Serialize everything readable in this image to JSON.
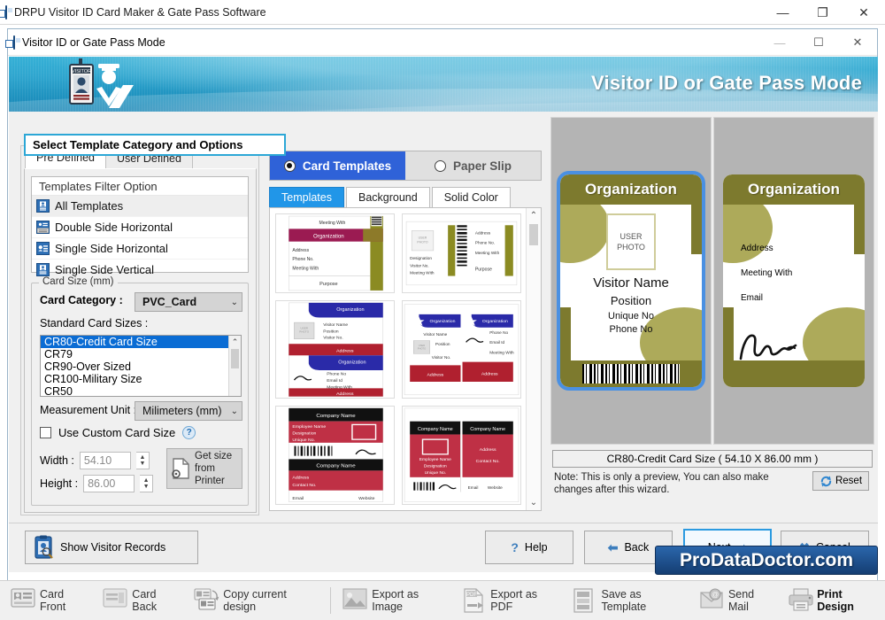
{
  "outer_window": {
    "title": "DRPU Visitor ID Card Maker & Gate Pass Software",
    "minimize": "—",
    "restore": "❐",
    "close": "✕"
  },
  "inner_window": {
    "title": "Visitor ID or Gate Pass Mode",
    "minimize": "—",
    "maximize": "☐",
    "close": "✕"
  },
  "banner": {
    "title": "Visitor ID or Gate Pass Mode"
  },
  "group_header": "Select Template Category and Options",
  "left_panel": {
    "tabs": [
      {
        "label": "Pre Defined",
        "active": true
      },
      {
        "label": "User Defined",
        "active": false
      }
    ],
    "filter": {
      "header": "Templates Filter Option",
      "items": [
        {
          "label": "All Templates",
          "selected": true
        },
        {
          "label": "Double Side Horizontal",
          "selected": false
        },
        {
          "label": "Single Side Horizontal",
          "selected": false
        },
        {
          "label": "Single Side Vertical",
          "selected": false
        }
      ]
    },
    "card_size": {
      "legend": "Card Size (mm)",
      "category_label": "Card Category :",
      "category_value": "PVC_Card",
      "standard_label": "Standard Card Sizes :",
      "sizes": [
        {
          "label": "CR80-Credit Card Size",
          "selected": true
        },
        {
          "label": "CR79",
          "selected": false
        },
        {
          "label": "CR90-Over Sized",
          "selected": false
        },
        {
          "label": "CR100-Military Size",
          "selected": false
        },
        {
          "label": "CR50",
          "selected": false
        }
      ],
      "unit_label": "Measurement Unit :",
      "unit_value": "Milimeters (mm)",
      "custom_checkbox": "Use Custom Card Size",
      "help_glyph": "?",
      "width_label": "Width :",
      "width_value": "54.10",
      "height_label": "Height :",
      "height_value": "86.00",
      "printer_button_line1": "Get size",
      "printer_button_line2": "from Printer"
    }
  },
  "middle_panel": {
    "modes": [
      {
        "label": "Card Templates",
        "selected": true
      },
      {
        "label": "Paper Slip",
        "selected": false
      }
    ],
    "subtabs": [
      {
        "label": "Templates",
        "active": true
      },
      {
        "label": "Background",
        "active": false
      },
      {
        "label": "Solid Color",
        "active": false
      }
    ],
    "templates": [
      {
        "id": "tpl-1",
        "style": "maroon-olive",
        "fields": [
          "Meeting With",
          "Organization",
          "Address",
          "Phone No.",
          "Meeting With",
          "Purpose"
        ]
      },
      {
        "id": "tpl-2",
        "style": "olive-barcode",
        "fields": [
          "USER PHOTO",
          "Designation",
          "Visitor No.",
          "Meeting With",
          "Address",
          "Phone No.",
          "Meeting With",
          "Purpose"
        ]
      },
      {
        "id": "tpl-3",
        "style": "blue-red-star",
        "fields": [
          "Organization",
          "Visitor Name",
          "Position",
          "Visitor No.",
          "Address",
          "Organization",
          "Phone No",
          "Email Id",
          "Meeting With",
          "Address"
        ]
      },
      {
        "id": "tpl-4",
        "style": "blue-red-star-pair",
        "fields": [
          "Organization",
          "Visitor Name",
          "Position",
          "Visitor No.",
          "Address",
          "Organization",
          "Phone No",
          "Email Id",
          "Meeting With",
          "Address"
        ]
      },
      {
        "id": "tpl-5",
        "style": "black-red",
        "fields": [
          "Company Name",
          "Employee Name",
          "Designation",
          "Unique No.",
          "Company Name",
          "Address",
          "Contact No.",
          "Email",
          "Website"
        ]
      },
      {
        "id": "tpl-6",
        "style": "black-red-pair",
        "fields": [
          "Company Name",
          "Company Name",
          "Employee Name",
          "Designation",
          "Unique No.",
          "Address",
          "Contact No.",
          "Email",
          "Website"
        ]
      }
    ],
    "scroll_up": "⌃",
    "scroll_down": "⌄"
  },
  "preview": {
    "front": {
      "organization": "Organization",
      "photo_line1": "USER",
      "photo_line2": "PHOTO",
      "name": "Visitor Name",
      "position": "Position",
      "unique_no": "Unique No",
      "phone_no": "Phone No",
      "selected": true
    },
    "back": {
      "organization": "Organization",
      "fields": [
        "Address",
        "Meeting With",
        "Email"
      ]
    },
    "size_bar": "CR80-Credit Card Size ( 54.10 X 86.00 mm )",
    "note": "Note: This is only a preview, You can also make changes after this wizard.",
    "reset_label": "Reset",
    "colors": {
      "header_olive": "#7d7a2e",
      "blob_olive": "#adaa5a",
      "selection_blue": "#4a90e2",
      "stage_grey": "#b4b4b4"
    }
  },
  "nav": {
    "show_records": "Show Visitor Records",
    "help": "Help",
    "back": "Back",
    "next": "Next",
    "cancel": "Cancel"
  },
  "watermark": "ProDataDoctor.com",
  "bottom_toolbar": [
    {
      "label": "Card Front",
      "icon": "card-front-icon",
      "bold": false
    },
    {
      "label": "Card Back",
      "icon": "card-back-icon",
      "bold": false
    },
    {
      "label": "Copy current design",
      "icon": "copy-design-icon",
      "bold": false
    },
    {
      "label": "Export as Image",
      "icon": "export-image-icon",
      "bold": false
    },
    {
      "label": "Export as PDF",
      "icon": "export-pdf-icon",
      "bold": false
    },
    {
      "label": "Save as Template",
      "icon": "save-template-icon",
      "bold": false
    },
    {
      "label": "Send Mail",
      "icon": "send-mail-icon",
      "bold": false
    },
    {
      "label": "Print Design",
      "icon": "print-design-icon",
      "bold": true
    }
  ]
}
